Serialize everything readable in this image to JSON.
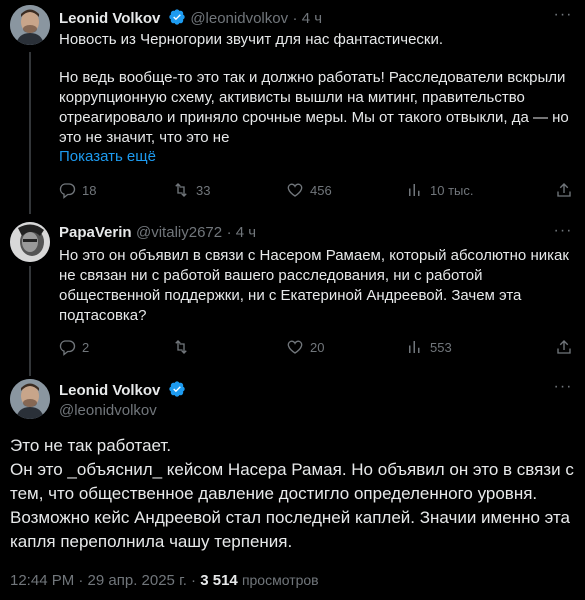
{
  "tweet1": {
    "name": "Leonid Volkov",
    "handle": "@leonidvolkov",
    "time": "· 4 ч",
    "text_p1": "Новость из Черногории звучит для нас фантастически.",
    "text_p2": "Но ведь вообще-то это так и должно работать! Расследователи вскрыли\nкоррупционную схему, активисты вышли на митинг, правительство\nотреагировало и приняло срочные меры. Мы от такого отвыкли, да — но\nэто не значит, что это не",
    "show_more": "Показать ещё",
    "replies": "18",
    "reposts": "33",
    "likes": "456",
    "views": "10 тыс."
  },
  "tweet2": {
    "name": "PapaVerin",
    "handle": "@vitaliy2672",
    "time": "· 4 ч",
    "text": "Но это он объявил в связи с Насером Рамаем, который абсолютно никак\nне связан ни с работой вашего расследования, ни с работой\nобщественной поддержки, ни с Екатериной Андреевой. Зачем эта\nподтасовка?",
    "replies": "2",
    "reposts": "",
    "likes": "20",
    "views": "553"
  },
  "tweet3": {
    "name": "Leonid Volkov",
    "handle": "@leonidvolkov",
    "text": "Это не так работает.\nОн это _объяснил_ кейсом Насера Рамая. Но объявил он это в связи с\nтем, что общественное давление достигло определенного уровня.\nВозможно кейс Андреевой стал последней каплей. Значии именно эта\nкапля переполнила чашу терпения.",
    "time": "12:44 PM · 29 апр. 2025 г. ·",
    "view_count": "3 514",
    "views_label": "просмотров"
  },
  "colors": {
    "background": "#000000",
    "text": "#e7e9ea",
    "muted": "#71767b",
    "link": "#1d9bf0",
    "verified": "#1d9bf0"
  },
  "icons": [
    "verified-badge-icon",
    "more-icon",
    "reply-icon",
    "repost-icon",
    "like-icon",
    "views-icon",
    "share-icon"
  ]
}
